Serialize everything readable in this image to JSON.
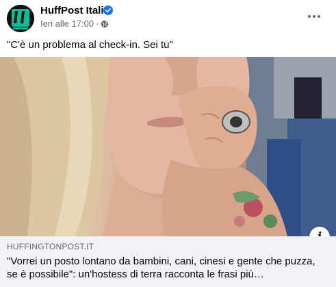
{
  "post": {
    "page_name": "HuffPost Italia",
    "timestamp": "Ieri alle 17:00",
    "separator": "·",
    "audience_icon": "globe-icon",
    "caption": "\"C'è un problema al check-in. Sei tu\"",
    "more_icon": "more-options-icon"
  },
  "link_preview": {
    "domain": "HUFFINGTONPOST.IT",
    "title": "\"Vorrei un posto lontano da bambini, cani, cinesi e gente che puzza, se è possibile\": un'hostess di terra racconta le frasi più…",
    "info_label": "i"
  },
  "colors": {
    "brand_green": "#0dbe98",
    "verified_blue": "#1877f2",
    "secondary_text": "#65676b",
    "link_bg": "#f0f2f5"
  }
}
